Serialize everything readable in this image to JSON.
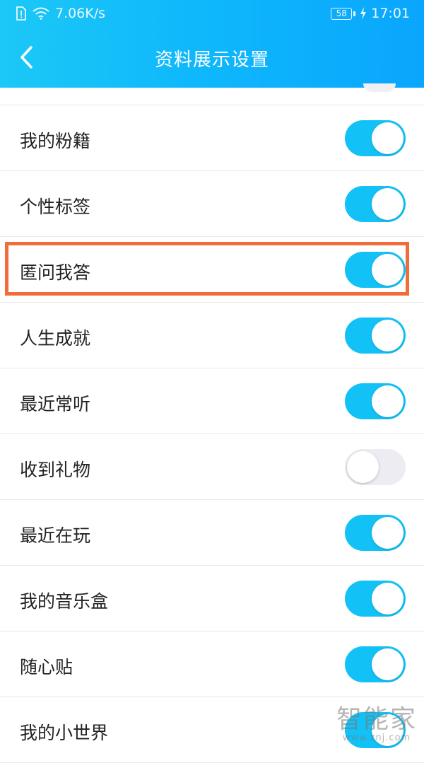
{
  "status_bar": {
    "net_speed": "7.06K/s",
    "battery_level": "58",
    "time": "17:01"
  },
  "header": {
    "title": "资料展示设置",
    "back_icon": "chevron-left-icon"
  },
  "colors": {
    "header_start": "#1cc8f6",
    "header_end": "#0aa6fd",
    "toggle_on": "#12c2f7",
    "toggle_off": "#ececf2",
    "highlight": "#f26b3a"
  },
  "settings": [
    {
      "label": "我的粉籍",
      "enabled": true
    },
    {
      "label": "个性标签",
      "enabled": true
    },
    {
      "label": "匿问我答",
      "enabled": true,
      "highlighted": true
    },
    {
      "label": "人生成就",
      "enabled": true
    },
    {
      "label": "最近常听",
      "enabled": true
    },
    {
      "label": "收到礼物",
      "enabled": false
    },
    {
      "label": "最近在玩",
      "enabled": true
    },
    {
      "label": "我的音乐盒",
      "enabled": true
    },
    {
      "label": "随心贴",
      "enabled": true
    },
    {
      "label": "我的小世界",
      "enabled": true
    }
  ],
  "watermark": {
    "main": "智能家",
    "sub": "www.znj.com"
  }
}
